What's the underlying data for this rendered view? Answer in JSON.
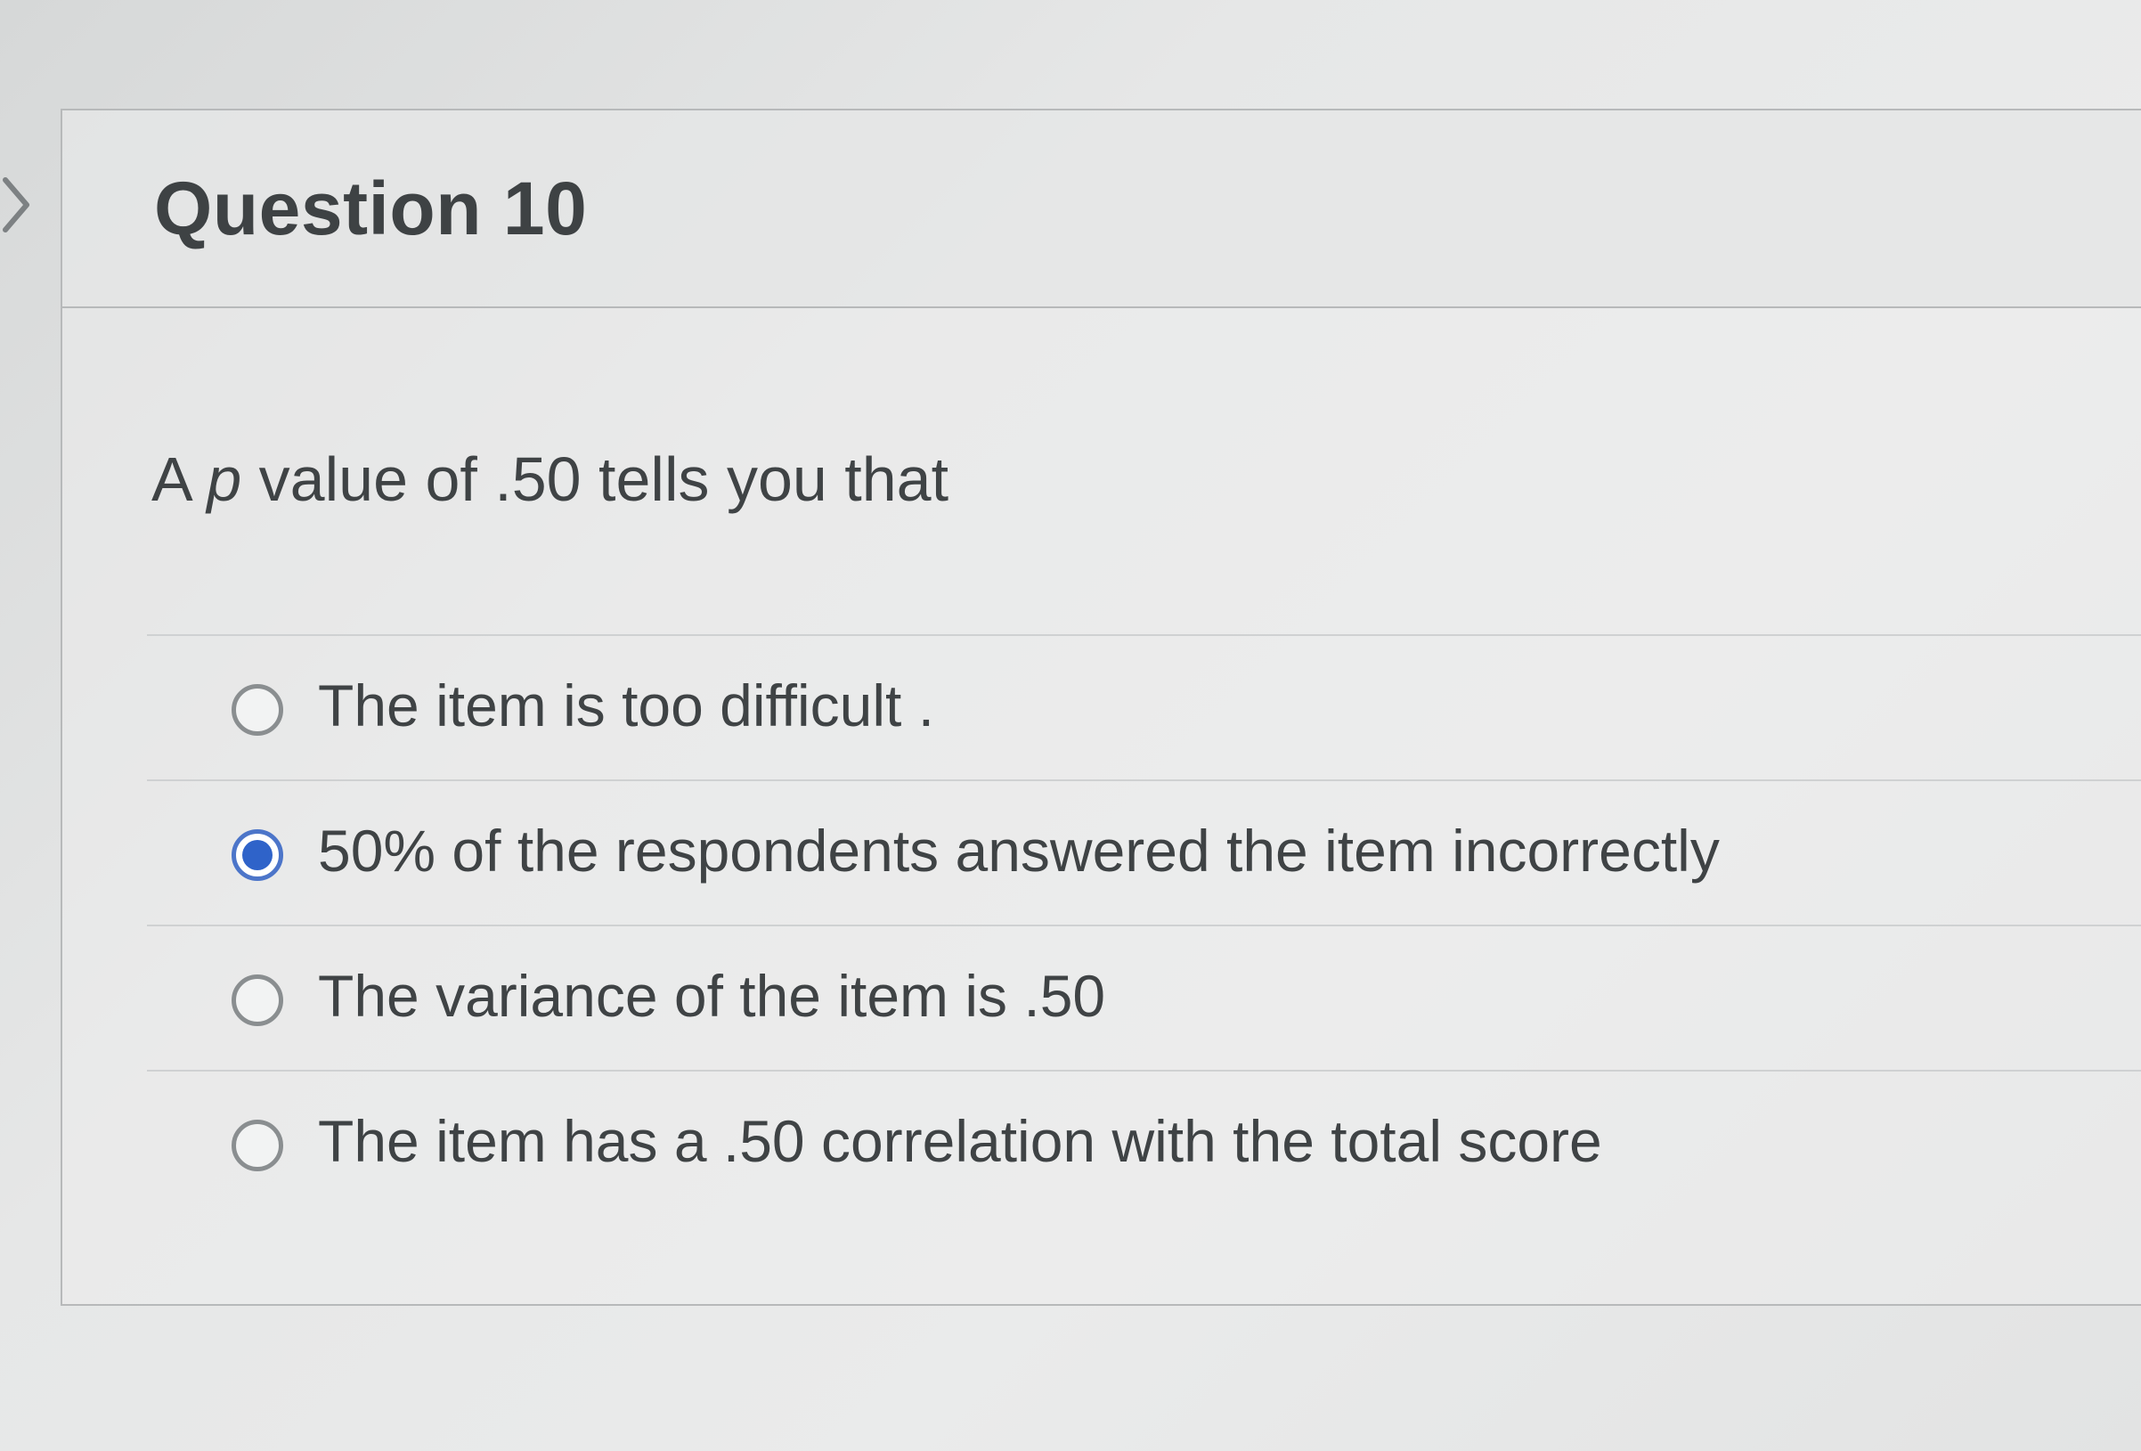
{
  "question": {
    "title": "Question 10",
    "prompt_prefix": "A ",
    "prompt_var": "p",
    "prompt_suffix": " value of .50 tells you that"
  },
  "answers": [
    {
      "label": "The item is too difficult .",
      "selected": false
    },
    {
      "label": "50% of the respondents answered the item incorrectly",
      "selected": true
    },
    {
      "label": "The variance of the item is .50",
      "selected": false
    },
    {
      "label": "The item has a .50 correlation with the total score",
      "selected": false
    }
  ],
  "colors": {
    "selected_radio": "#2f63c9",
    "text": "#3f4345",
    "border": "#b7b9ba"
  },
  "icons": {
    "nav": "chevron-right-icon"
  }
}
